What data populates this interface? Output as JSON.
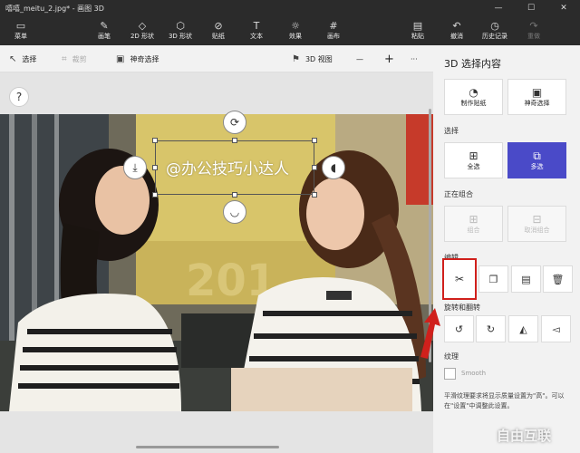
{
  "window": {
    "title": "嘻嘻_meitu_2.jpg* - 画图 3D",
    "minimize": "—",
    "maximize": "☐",
    "close": "✕"
  },
  "ribbon": {
    "menu": "菜单",
    "brushes": "画笔",
    "shapes2d": "2D 形状",
    "shapes3d": "3D 形状",
    "stickers": "贴纸",
    "text": "文本",
    "effects": "效果",
    "canvas": "画布",
    "paste": "粘贴",
    "undo": "撤消",
    "history": "历史记录",
    "redo": "重做"
  },
  "toolbar": {
    "select": "选择",
    "crop": "裁剪",
    "magic_select": "神奇选择",
    "view3d": "3D 视图",
    "zoom_out": "—",
    "zoom_in": "+",
    "more": "···"
  },
  "canvas": {
    "help": "?",
    "sticker_text": "@办公技巧小达人"
  },
  "panel": {
    "title": "3D 选择内容",
    "make_sticker": "制作贴纸",
    "magic_select": "神奇选择",
    "section_select": "选择",
    "select_all": "全选",
    "multi_select": "多选",
    "section_group": "正在组合",
    "group": "组合",
    "ungroup": "取消组合",
    "section_edit": "编辑",
    "section_rotate": "旋转和翻转",
    "section_texture": "纹理",
    "smooth": "Smooth",
    "note": "平滑纹理要求将显示质量设置为\"高\"。可以在\"设置\"中调整此设置。"
  },
  "watermark": "自由互联",
  "colors": {
    "chrome": "#2b2b2b",
    "accent": "#4a4ac8",
    "highlight": "#d0201c"
  }
}
